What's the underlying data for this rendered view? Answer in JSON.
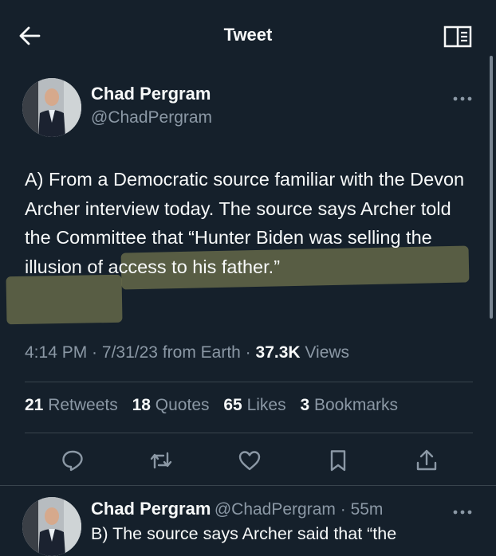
{
  "header": {
    "title": "Tweet"
  },
  "tweet": {
    "author_name": "Chad Pergram",
    "author_handle": "@ChadPergram",
    "text_before_highlight": "A) From a Democratic source familiar with the Devon Archer interview today. The source says Archer told the Committee that “Hunter Biden was ",
    "text_highlight": "selling the illusion of access to his father.”",
    "time": "4:14 PM",
    "date": "7/31/23",
    "source": "from Earth",
    "views_count": "37.3K",
    "views_label": "Views",
    "stats": {
      "retweets_count": "21",
      "retweets_label": "Retweets",
      "quotes_count": "18",
      "quotes_label": "Quotes",
      "likes_count": "65",
      "likes_label": "Likes",
      "bookmarks_count": "3",
      "bookmarks_label": "Bookmarks"
    }
  },
  "reply": {
    "author_name": "Chad Pergram",
    "author_handle": "@ChadPergram",
    "time": "55m",
    "text": "B) The source says Archer said that “the"
  },
  "colors": {
    "background": "#15202b",
    "secondary_text": "#8b98a5",
    "divider": "#38444d",
    "highlight": "#8f8f5a"
  },
  "icons": [
    "back-arrow-icon",
    "reader-mode-icon",
    "more-icon",
    "reply-icon",
    "retweet-icon",
    "like-icon",
    "bookmark-icon",
    "share-icon"
  ]
}
